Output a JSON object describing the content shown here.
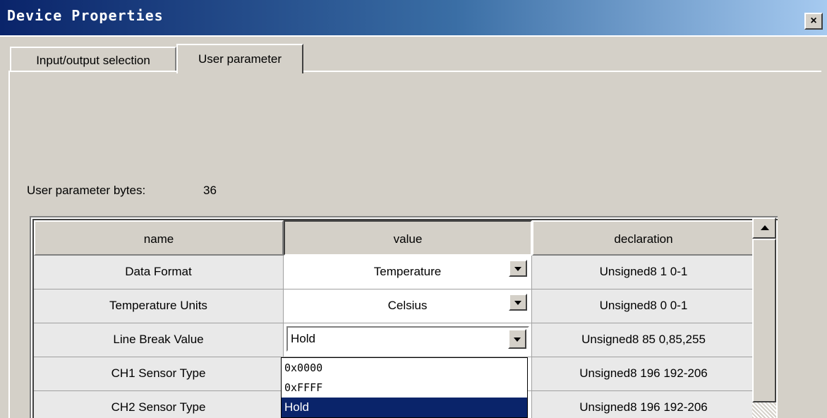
{
  "window": {
    "title": "Device Properties",
    "close_glyph": "×"
  },
  "tabs": [
    {
      "label": "Input/output selection",
      "selected": false
    },
    {
      "label": "User parameter",
      "selected": true
    }
  ],
  "user_params": {
    "bytes_label": "User parameter bytes:",
    "bytes_value": "36"
  },
  "grid": {
    "columns": [
      "name",
      "value",
      "declaration"
    ],
    "rows": [
      {
        "name": "Data Format",
        "value": "Temperature",
        "declaration": "Unsigned8  1 0-1"
      },
      {
        "name": "Temperature Units",
        "value": "Celsius",
        "declaration": "Unsigned8  0 0-1"
      },
      {
        "name": "Line Break Value",
        "value": "Hold",
        "declaration": "Unsigned8  85 0,85,255"
      },
      {
        "name": "CH1 Sensor Type",
        "value": "",
        "declaration": "Unsigned8 196 192-206"
      },
      {
        "name": "CH2 Sensor Type",
        "value": "",
        "declaration": "Unsigned8 196 192-206"
      }
    ]
  },
  "dropdown": {
    "options": [
      "0x0000",
      "0xFFFF",
      "Hold"
    ],
    "selected": "Hold"
  },
  "icons": {
    "combo_arrow": "chevron-down-icon",
    "scroll_up": "arrow-up-icon",
    "close": "close-icon"
  },
  "colors": {
    "title_gradient_start": "#0a246a",
    "title_gradient_end": "#a6caf0",
    "selection": "#0a246a",
    "face": "#d4d0c8"
  }
}
